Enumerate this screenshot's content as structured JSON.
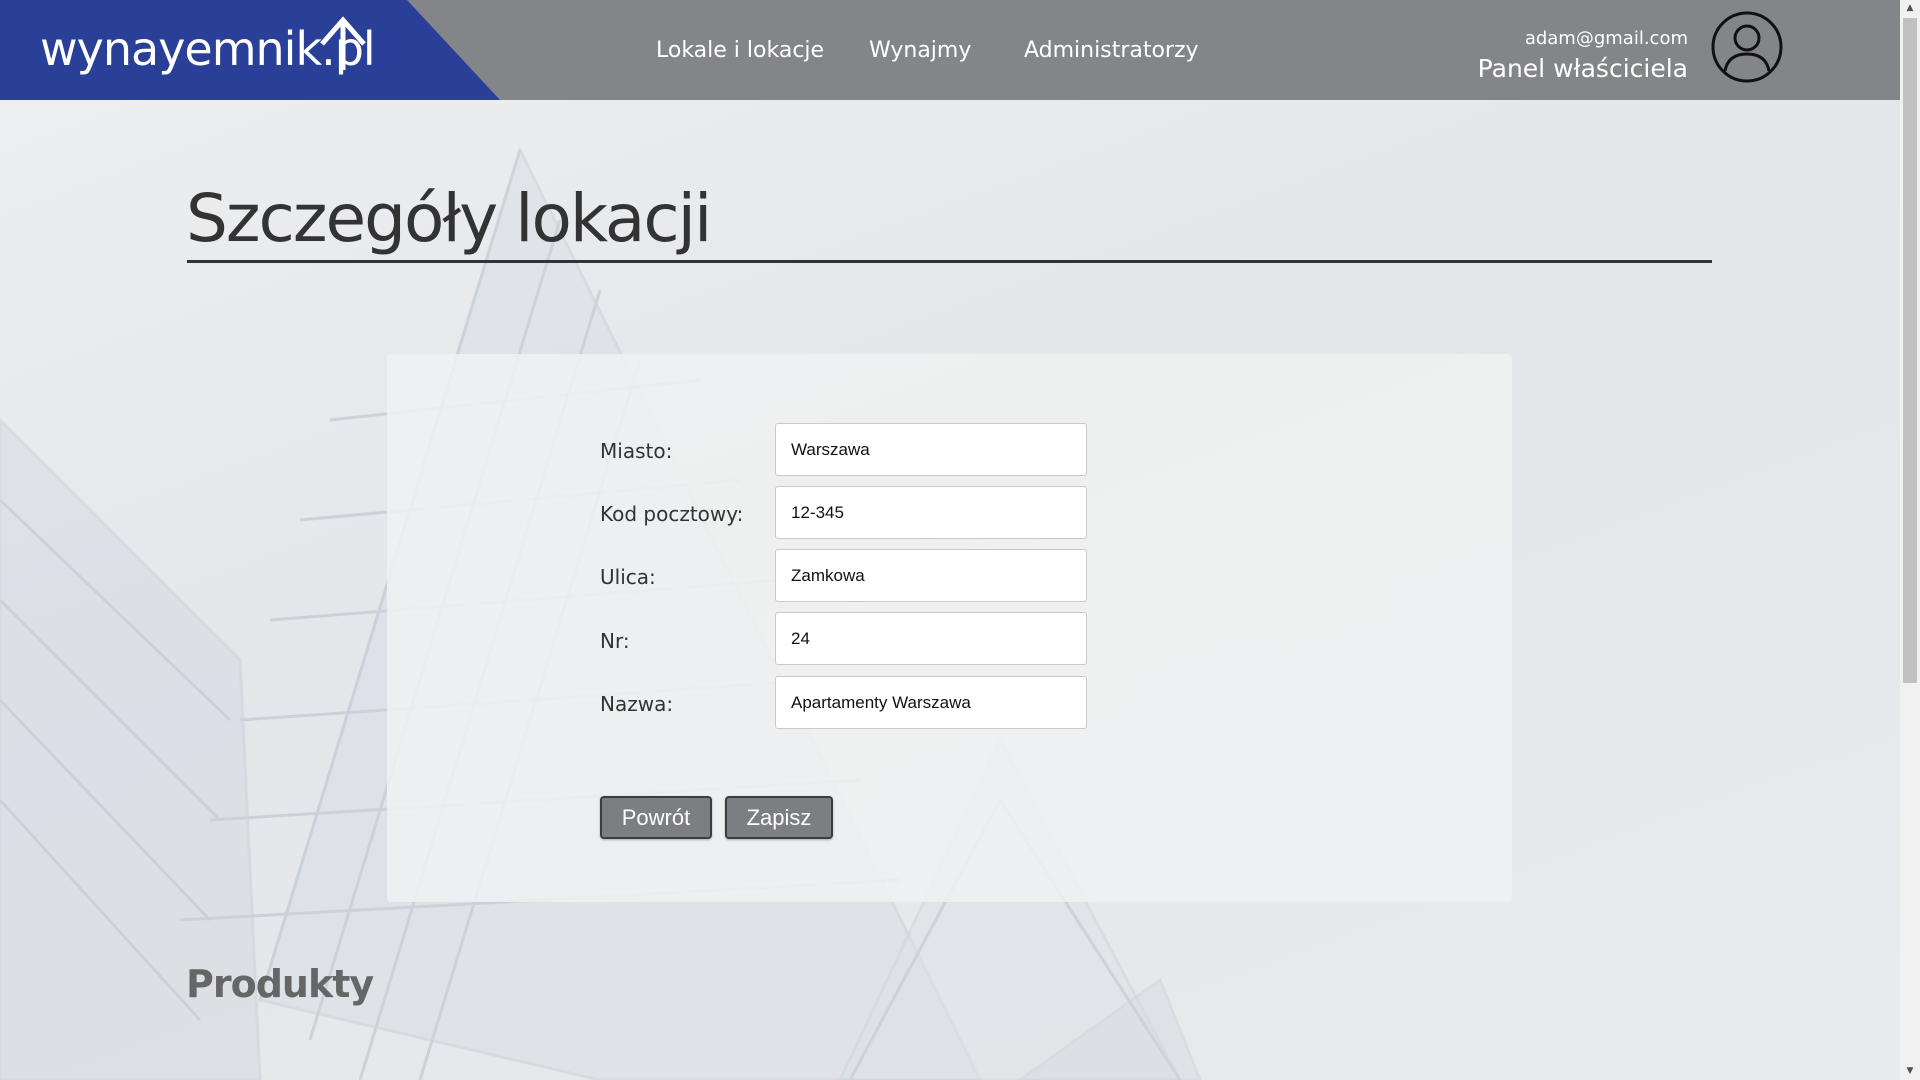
{
  "brand": {
    "logo_text": "wynayemnik.pl"
  },
  "nav": {
    "items": [
      {
        "label": "Lokale i lokacje"
      },
      {
        "label": "Wynajmy"
      },
      {
        "label": "Administratorzy"
      }
    ]
  },
  "user": {
    "email": "adam@gmail.com",
    "role": "Panel właściciela"
  },
  "page": {
    "title": "Szczegóły lokacji",
    "section_title": "Produkty"
  },
  "form": {
    "fields": [
      {
        "label": "Miasto:",
        "value": "Warszawa"
      },
      {
        "label": "Kod pocztowy:",
        "value": "12-345"
      },
      {
        "label": "Ulica:",
        "value": "Zamkowa"
      },
      {
        "label": "Nr:",
        "value": "24"
      },
      {
        "label": "Nazwa:",
        "value": "Apartamenty Warszawa"
      }
    ],
    "back_label": "Powrót",
    "save_label": "Zapisz"
  },
  "colors": {
    "header_bg": "#848589",
    "logo_bg": "#2a3f97",
    "button_bg": "#7d7e82",
    "title_text": "#333333"
  },
  "icons": {
    "avatar": "user-circle-icon",
    "logo": "house-roof-icon"
  }
}
